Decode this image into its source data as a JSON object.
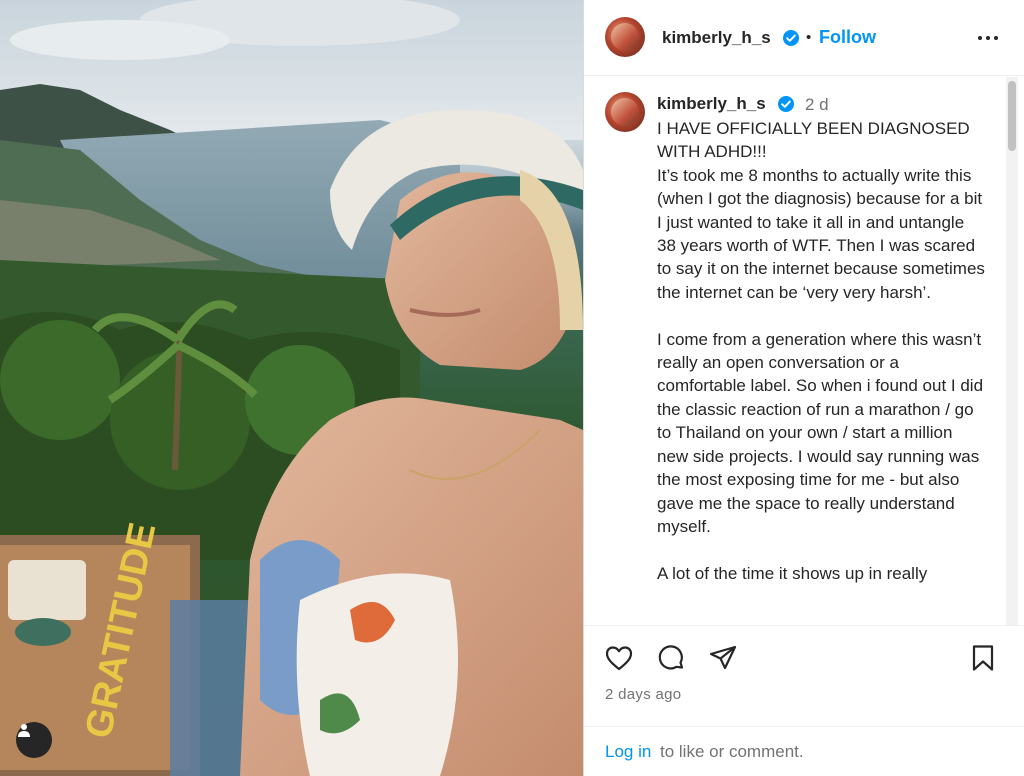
{
  "post": {
    "username": "kimberly_h_s",
    "follow_label": "Follow",
    "separator": "•",
    "time_short": "2 d",
    "caption": "I HAVE OFFICIALLY BEEN DIAGNOSED WITH ADHD!!!\nIt’s took me 8 months to actually write this (when I got the diagnosis) because for a bit I just wanted to take it all in and untangle 38 years worth of WTF. Then I was scared to say it on the internet because sometimes the internet can be ‘very very harsh’.\n\nI come from a generation where this wasn’t really an open conversation or a comfortable label. So when i found out I did the classic reaction of run a marathon / go to Thailand on your own / start a million new side projects. I would say running was the most exposing time for me - but also gave me the space to really understand myself.\n\nA lot of the time it shows up in really",
    "date_label": "2 days ago",
    "login_link": "Log in",
    "login_rest": "to like or comment."
  },
  "icons": {
    "verified": "verified-badge-icon",
    "more": "more-options-icon",
    "like": "heart-icon",
    "comment": "comment-bubble-icon",
    "share": "paper-plane-icon",
    "save": "bookmark-icon",
    "user": "user-silhouette-icon"
  },
  "colors": {
    "accent": "#0095f6",
    "muted": "#737373",
    "text": "#262626"
  }
}
